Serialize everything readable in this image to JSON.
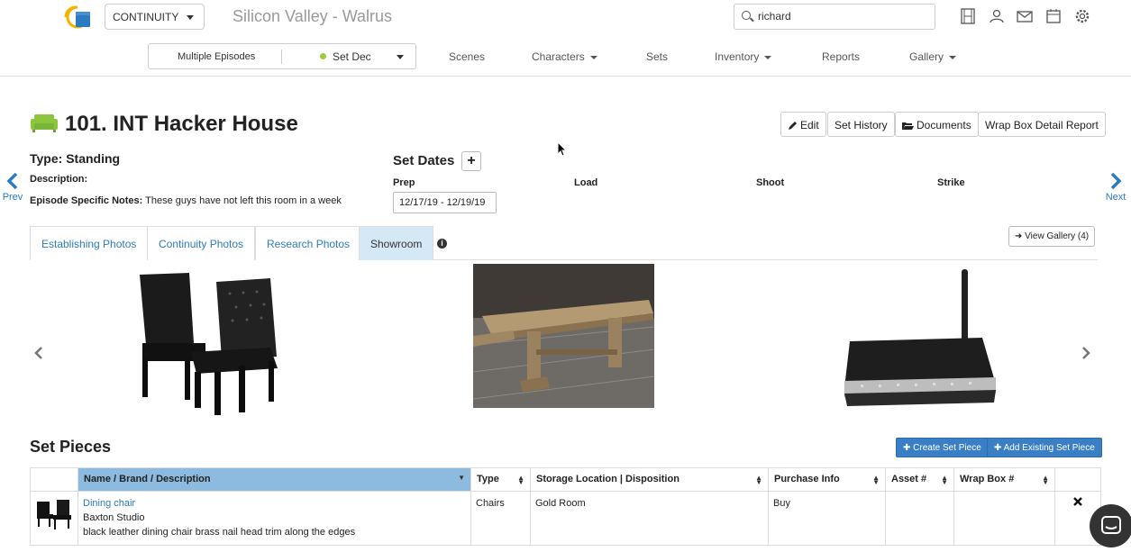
{
  "topbar": {
    "app_name": "CONTINUITY",
    "project_title": "Silicon Valley - Walrus",
    "search_value": "richard",
    "icons": [
      "film-icon",
      "user-settings-icon",
      "mail-icon",
      "calendar-icon",
      "gear-icon"
    ]
  },
  "nav": {
    "episode": "Multiple Episodes",
    "department": "Set Dec",
    "items": [
      "Scenes",
      "Characters",
      "Sets",
      "Inventory",
      "Reports",
      "Gallery"
    ]
  },
  "header": {
    "title": "101. INT Hacker House",
    "buttons": {
      "edit": "Edit",
      "set_history": "Set History",
      "documents": "Documents",
      "wrap_box": "Wrap Box Detail Report"
    },
    "prev": "Prev",
    "next": "Next"
  },
  "info": {
    "type": "Type: Standing",
    "description_label": "Description:",
    "notes_label": "Episode Specific Notes:",
    "notes_value": "These guys have not left this room in a week"
  },
  "set_dates": {
    "label": "Set Dates",
    "add": "+",
    "columns": [
      "Prep",
      "Load",
      "Shoot",
      "Strike"
    ],
    "prep_value": "12/17/19 - 12/19/19"
  },
  "tabs": {
    "items": [
      "Establishing Photos",
      "Continuity Photos",
      "Research Photos",
      "Showroom"
    ],
    "active": "Showroom",
    "info": "i",
    "view_gallery": "View Gallery (4)"
  },
  "gallery": {
    "photos": [
      "dining-chairs-photo",
      "wooden-table-photo",
      "router-photo"
    ]
  },
  "set_pieces": {
    "title": "Set Pieces",
    "create_button": "Create Set Piece",
    "add_existing_button": "Add Existing Set Piece",
    "columns": [
      "Name / Brand / Description",
      "Type",
      "Storage Location | Disposition",
      "Purchase Info",
      "Asset #",
      "Wrap Box #"
    ],
    "rows": [
      {
        "name": "Dining chair",
        "brand": "Baxton Studio",
        "description": "black leather dining chair brass nail head trim along the edges",
        "type": "Chairs",
        "storage": "Gold Room",
        "purchase": "Buy",
        "asset": "",
        "wrap_box": ""
      }
    ]
  },
  "colors": {
    "accent": "#2c7bc0",
    "sorted_header": "#8dbbe0",
    "active_tab": "#d4e8f5",
    "primary_button": "#3a7fc5",
    "status_dot": "#9ccc3c"
  }
}
